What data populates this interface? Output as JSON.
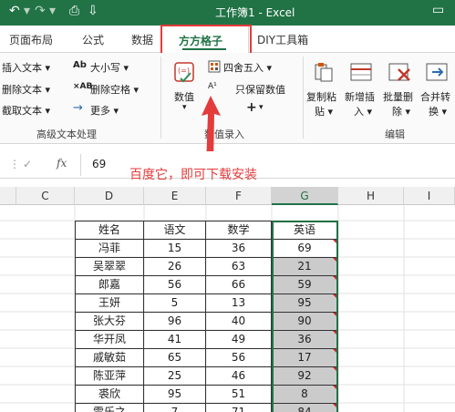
{
  "titlebar": {
    "title": "工作簿1  -  Excel",
    "undo_icon": "undo-icon",
    "redo_icon": "redo-icon",
    "save_icon": "save-icon",
    "restore_icon": "restore-icon"
  },
  "tabs": [
    {
      "label": "页面布局"
    },
    {
      "label": "公式"
    },
    {
      "label": "数据"
    },
    {
      "label": "方方格子",
      "active": true
    },
    {
      "label": "DIY工具箱"
    }
  ],
  "ribbon": {
    "text_group": {
      "items": [
        "插入文本",
        "删除文本",
        "截取文本"
      ],
      "items2": [
        "大小写",
        "删除空格",
        "更多"
      ],
      "label": "高级文本处理"
    },
    "number_group": {
      "value_label": "数值",
      "round_label": "四舍五入",
      "keep_label": "只保留数值",
      "plus_label": "+",
      "label": "数值录入"
    },
    "edit_group": {
      "buttons": [
        {
          "line1": "复制粘",
          "line2": "贴"
        },
        {
          "line1": "新增插",
          "line2": "入"
        },
        {
          "line1": "批量删",
          "line2": "除"
        },
        {
          "line1": "合并转",
          "line2": "换"
        }
      ],
      "label": "编辑"
    },
    "colors": {
      "accent": "#217346",
      "highlight_red": "#e43b3b"
    }
  },
  "formula_bar": {
    "cancel": "✓",
    "value": "69"
  },
  "annotation": "百度它，即可下载安装",
  "grid": {
    "columns": [
      "C",
      "D",
      "E",
      "F",
      "G",
      "H",
      "I"
    ],
    "selected_column": "G",
    "header": [
      "姓名",
      "语文",
      "数学",
      "英语"
    ],
    "rows": [
      [
        "冯菲",
        "15",
        "36",
        "69"
      ],
      [
        "吴翠翠",
        "26",
        "63",
        "21"
      ],
      [
        "郎嘉",
        "56",
        "66",
        "59"
      ],
      [
        "王妍",
        "5",
        "13",
        "95"
      ],
      [
        "张大芬",
        "96",
        "40",
        "90"
      ],
      [
        "华开凤",
        "41",
        "49",
        "36"
      ],
      [
        "戚敏茹",
        "65",
        "56",
        "17"
      ],
      [
        "陈亚萍",
        "25",
        "46",
        "92"
      ],
      [
        "裘欣",
        "95",
        "51",
        "8"
      ],
      [
        "雷乐之",
        "7",
        "71",
        "84"
      ]
    ]
  }
}
